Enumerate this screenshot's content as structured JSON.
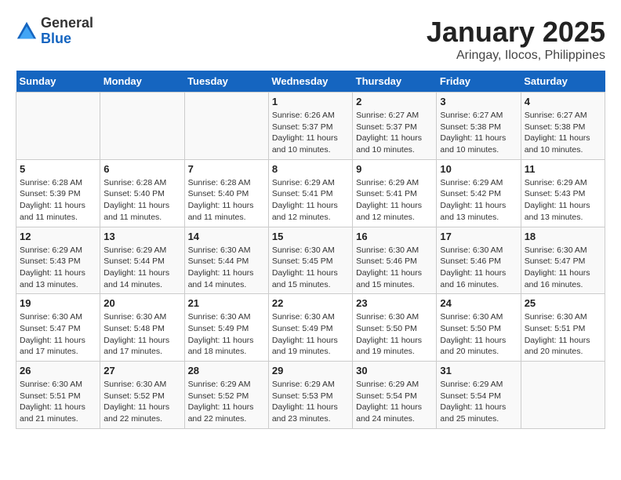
{
  "logo": {
    "general": "General",
    "blue": "Blue"
  },
  "title": "January 2025",
  "subtitle": "Aringay, Ilocos, Philippines",
  "days_of_week": [
    "Sunday",
    "Monday",
    "Tuesday",
    "Wednesday",
    "Thursday",
    "Friday",
    "Saturday"
  ],
  "weeks": [
    [
      {
        "day": "",
        "sunrise": "",
        "sunset": "",
        "daylight": ""
      },
      {
        "day": "",
        "sunrise": "",
        "sunset": "",
        "daylight": ""
      },
      {
        "day": "",
        "sunrise": "",
        "sunset": "",
        "daylight": ""
      },
      {
        "day": "1",
        "sunrise": "Sunrise: 6:26 AM",
        "sunset": "Sunset: 5:37 PM",
        "daylight": "Daylight: 11 hours and 10 minutes."
      },
      {
        "day": "2",
        "sunrise": "Sunrise: 6:27 AM",
        "sunset": "Sunset: 5:37 PM",
        "daylight": "Daylight: 11 hours and 10 minutes."
      },
      {
        "day": "3",
        "sunrise": "Sunrise: 6:27 AM",
        "sunset": "Sunset: 5:38 PM",
        "daylight": "Daylight: 11 hours and 10 minutes."
      },
      {
        "day": "4",
        "sunrise": "Sunrise: 6:27 AM",
        "sunset": "Sunset: 5:38 PM",
        "daylight": "Daylight: 11 hours and 10 minutes."
      }
    ],
    [
      {
        "day": "5",
        "sunrise": "Sunrise: 6:28 AM",
        "sunset": "Sunset: 5:39 PM",
        "daylight": "Daylight: 11 hours and 11 minutes."
      },
      {
        "day": "6",
        "sunrise": "Sunrise: 6:28 AM",
        "sunset": "Sunset: 5:40 PM",
        "daylight": "Daylight: 11 hours and 11 minutes."
      },
      {
        "day": "7",
        "sunrise": "Sunrise: 6:28 AM",
        "sunset": "Sunset: 5:40 PM",
        "daylight": "Daylight: 11 hours and 11 minutes."
      },
      {
        "day": "8",
        "sunrise": "Sunrise: 6:29 AM",
        "sunset": "Sunset: 5:41 PM",
        "daylight": "Daylight: 11 hours and 12 minutes."
      },
      {
        "day": "9",
        "sunrise": "Sunrise: 6:29 AM",
        "sunset": "Sunset: 5:41 PM",
        "daylight": "Daylight: 11 hours and 12 minutes."
      },
      {
        "day": "10",
        "sunrise": "Sunrise: 6:29 AM",
        "sunset": "Sunset: 5:42 PM",
        "daylight": "Daylight: 11 hours and 13 minutes."
      },
      {
        "day": "11",
        "sunrise": "Sunrise: 6:29 AM",
        "sunset": "Sunset: 5:43 PM",
        "daylight": "Daylight: 11 hours and 13 minutes."
      }
    ],
    [
      {
        "day": "12",
        "sunrise": "Sunrise: 6:29 AM",
        "sunset": "Sunset: 5:43 PM",
        "daylight": "Daylight: 11 hours and 13 minutes."
      },
      {
        "day": "13",
        "sunrise": "Sunrise: 6:29 AM",
        "sunset": "Sunset: 5:44 PM",
        "daylight": "Daylight: 11 hours and 14 minutes."
      },
      {
        "day": "14",
        "sunrise": "Sunrise: 6:30 AM",
        "sunset": "Sunset: 5:44 PM",
        "daylight": "Daylight: 11 hours and 14 minutes."
      },
      {
        "day": "15",
        "sunrise": "Sunrise: 6:30 AM",
        "sunset": "Sunset: 5:45 PM",
        "daylight": "Daylight: 11 hours and 15 minutes."
      },
      {
        "day": "16",
        "sunrise": "Sunrise: 6:30 AM",
        "sunset": "Sunset: 5:46 PM",
        "daylight": "Daylight: 11 hours and 15 minutes."
      },
      {
        "day": "17",
        "sunrise": "Sunrise: 6:30 AM",
        "sunset": "Sunset: 5:46 PM",
        "daylight": "Daylight: 11 hours and 16 minutes."
      },
      {
        "day": "18",
        "sunrise": "Sunrise: 6:30 AM",
        "sunset": "Sunset: 5:47 PM",
        "daylight": "Daylight: 11 hours and 16 minutes."
      }
    ],
    [
      {
        "day": "19",
        "sunrise": "Sunrise: 6:30 AM",
        "sunset": "Sunset: 5:47 PM",
        "daylight": "Daylight: 11 hours and 17 minutes."
      },
      {
        "day": "20",
        "sunrise": "Sunrise: 6:30 AM",
        "sunset": "Sunset: 5:48 PM",
        "daylight": "Daylight: 11 hours and 17 minutes."
      },
      {
        "day": "21",
        "sunrise": "Sunrise: 6:30 AM",
        "sunset": "Sunset: 5:49 PM",
        "daylight": "Daylight: 11 hours and 18 minutes."
      },
      {
        "day": "22",
        "sunrise": "Sunrise: 6:30 AM",
        "sunset": "Sunset: 5:49 PM",
        "daylight": "Daylight: 11 hours and 19 minutes."
      },
      {
        "day": "23",
        "sunrise": "Sunrise: 6:30 AM",
        "sunset": "Sunset: 5:50 PM",
        "daylight": "Daylight: 11 hours and 19 minutes."
      },
      {
        "day": "24",
        "sunrise": "Sunrise: 6:30 AM",
        "sunset": "Sunset: 5:50 PM",
        "daylight": "Daylight: 11 hours and 20 minutes."
      },
      {
        "day": "25",
        "sunrise": "Sunrise: 6:30 AM",
        "sunset": "Sunset: 5:51 PM",
        "daylight": "Daylight: 11 hours and 20 minutes."
      }
    ],
    [
      {
        "day": "26",
        "sunrise": "Sunrise: 6:30 AM",
        "sunset": "Sunset: 5:51 PM",
        "daylight": "Daylight: 11 hours and 21 minutes."
      },
      {
        "day": "27",
        "sunrise": "Sunrise: 6:30 AM",
        "sunset": "Sunset: 5:52 PM",
        "daylight": "Daylight: 11 hours and 22 minutes."
      },
      {
        "day": "28",
        "sunrise": "Sunrise: 6:29 AM",
        "sunset": "Sunset: 5:52 PM",
        "daylight": "Daylight: 11 hours and 22 minutes."
      },
      {
        "day": "29",
        "sunrise": "Sunrise: 6:29 AM",
        "sunset": "Sunset: 5:53 PM",
        "daylight": "Daylight: 11 hours and 23 minutes."
      },
      {
        "day": "30",
        "sunrise": "Sunrise: 6:29 AM",
        "sunset": "Sunset: 5:54 PM",
        "daylight": "Daylight: 11 hours and 24 minutes."
      },
      {
        "day": "31",
        "sunrise": "Sunrise: 6:29 AM",
        "sunset": "Sunset: 5:54 PM",
        "daylight": "Daylight: 11 hours and 25 minutes."
      },
      {
        "day": "",
        "sunrise": "",
        "sunset": "",
        "daylight": ""
      }
    ]
  ]
}
